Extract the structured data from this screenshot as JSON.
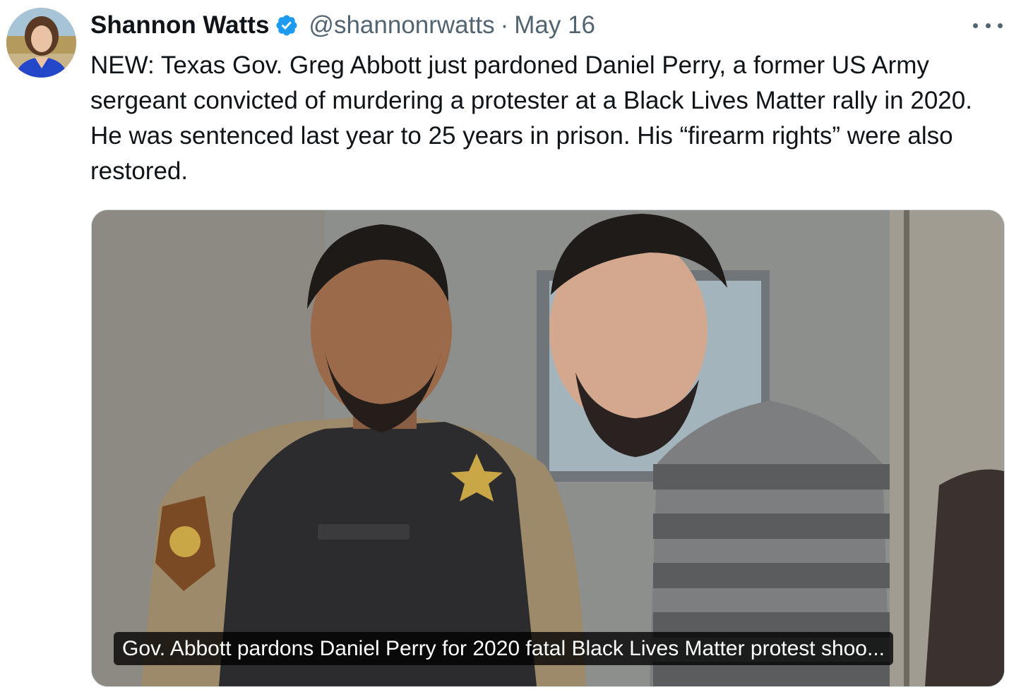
{
  "tweet": {
    "author": {
      "display_name": "Shannon Watts",
      "verified_icon": "verified-badge-icon",
      "handle": "@shannonrwatts",
      "separator": "·",
      "date": "May 16"
    },
    "more_icon": "more-options-icon",
    "text": "NEW: Texas Gov. Greg Abbott just pardoned Daniel Perry, a former US Army sergeant convicted of murdering a protester at a Black Lives Matter rally in 2020. He was sentenced last year to 25 years in prison. His “firearm rights” were also restored.",
    "link_card": {
      "caption": "Gov. Abbott pardons Daniel Perry for 2020 fatal Black Lives Matter protest shoo..."
    }
  },
  "colors": {
    "text_primary": "#0f1419",
    "text_secondary": "#536471",
    "verified_blue": "#1d9bf0",
    "card_border": "#cfd9de"
  }
}
